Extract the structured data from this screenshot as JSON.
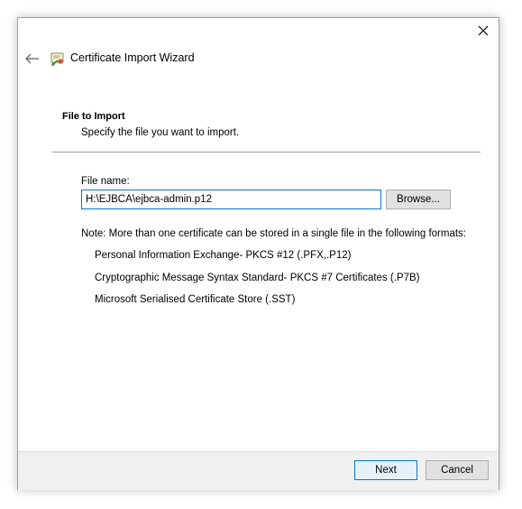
{
  "window": {
    "title": "Certificate Import Wizard"
  },
  "section": {
    "heading": "File to Import",
    "subheading": "Specify the file you want to import."
  },
  "file": {
    "label": "File name:",
    "value": "H:\\EJBCA\\ejbca-admin.p12",
    "browse_label": "Browse..."
  },
  "note": {
    "text": "Note:  More than one certificate can be stored in a single file in the following formats:",
    "formats": [
      "Personal Information Exchange- PKCS #12 (.PFX,.P12)",
      "Cryptographic Message Syntax Standard- PKCS #7 Certificates (.P7B)",
      "Microsoft Serialised Certificate Store (.SST)"
    ]
  },
  "footer": {
    "next_label": "Next",
    "cancel_label": "Cancel"
  },
  "colors": {
    "accent": "#0078d7",
    "footer_bg": "#f0f0f0"
  },
  "icons": {
    "close": "close-icon",
    "back": "back-arrow-icon",
    "certificate": "certificate-icon"
  }
}
